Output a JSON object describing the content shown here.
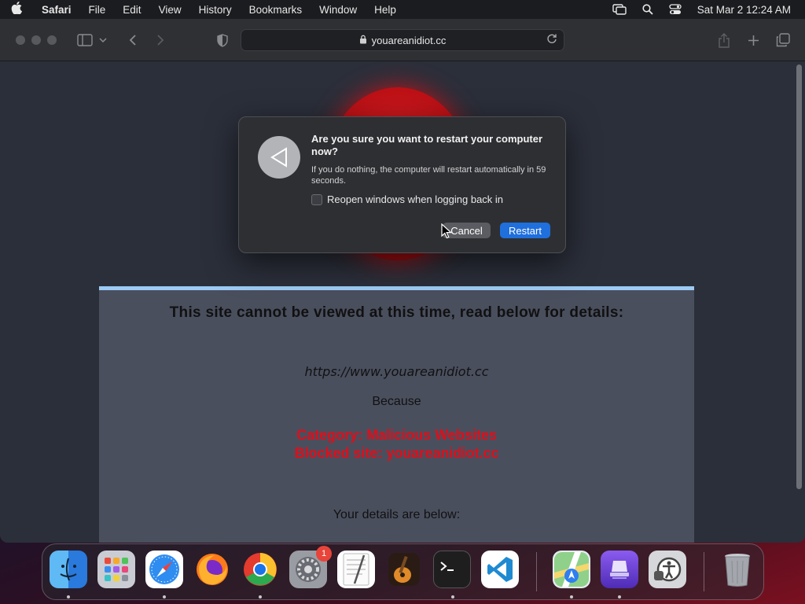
{
  "menubar": {
    "items": [
      "Safari",
      "File",
      "Edit",
      "View",
      "History",
      "Bookmarks",
      "Window",
      "Help"
    ],
    "clock": "Sat Mar 2  12:24 AM",
    "icons": [
      "apple-icon",
      "screen-mirroring-icon",
      "spotlight-search-icon",
      "control-center-icon"
    ]
  },
  "browser": {
    "address": "youareanidiot.cc",
    "toolbar_icons": [
      "sidebar-icon",
      "chevron-down-icon",
      "back-arrow-icon",
      "forward-arrow-icon",
      "privacy-shield-icon",
      "share-icon",
      "new-tab-icon",
      "tab-overview-icon"
    ]
  },
  "page": {
    "heading": "This site cannot be viewed at this time, read below for details:",
    "url": "https://www.youareanidiot.cc",
    "because": "Because",
    "category": "Category: Malicious Websites",
    "blocked": "Blocked site: youareanidiot.cc",
    "details": "Your details are below:"
  },
  "dialog": {
    "title": "Are you sure you want to restart your computer now?",
    "message": "If you do nothing, the computer will restart automatically in 59 seconds.",
    "checkbox_label": "Reopen windows when logging back in",
    "checkbox_checked": false,
    "cancel_label": "Cancel",
    "restart_label": "Restart",
    "icon": "restart-icon"
  },
  "dock": {
    "apps": [
      "finder",
      "launchpad",
      "safari",
      "firefox",
      "chrome",
      "system-settings",
      "textedit",
      "garageband",
      "terminal",
      "vscode",
      "maps",
      "apple-configurator",
      "accessibility-inspector",
      "trash"
    ],
    "settings_badge": "1"
  },
  "colors": {
    "accent": "#1f6fdd",
    "blocked_text": "#e00e1a",
    "panel_top": "#9ccbf3"
  }
}
